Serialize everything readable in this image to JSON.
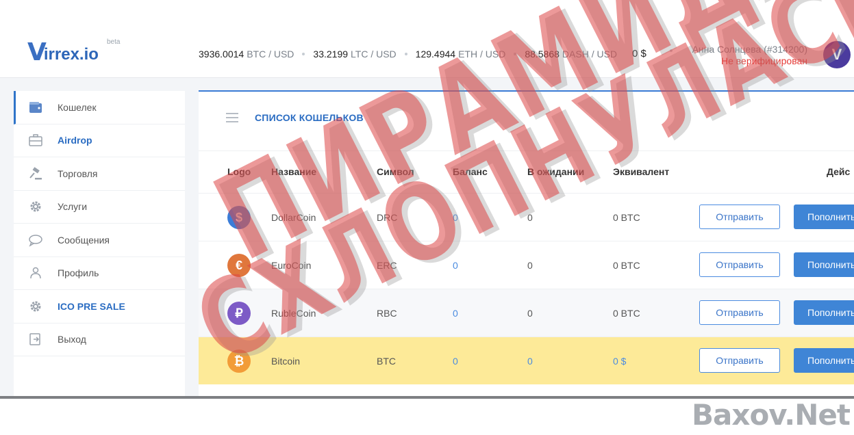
{
  "header": {
    "logo_mark": "V",
    "logo_text": "irrex.io",
    "logo_badge": "beta",
    "rates": [
      {
        "value": "3936.0014",
        "pair": "BTC / USD"
      },
      {
        "value": "33.2199",
        "pair": "LTC / USD"
      },
      {
        "value": "129.4944",
        "pair": "ETH / USD"
      },
      {
        "value": "88.5868",
        "pair": "DASH / USD"
      }
    ],
    "balance": "0 $",
    "user_name": "Анна Солнцева (#314200)",
    "user_status": "Не верифицирован",
    "avatar_letter": "V"
  },
  "sidebar": {
    "items": [
      {
        "label": "Кошелек",
        "icon": "wallet-icon"
      },
      {
        "label": "Airdrop",
        "icon": "briefcase-icon"
      },
      {
        "label": "Торговля",
        "icon": "gavel-icon"
      },
      {
        "label": "Услуги",
        "icon": "gear-icon"
      },
      {
        "label": "Сообщения",
        "icon": "chat-icon"
      },
      {
        "label": "Профиль",
        "icon": "user-icon"
      },
      {
        "label": "ICO PRE SALE",
        "icon": "gear-icon"
      },
      {
        "label": "Выход",
        "icon": "logout-icon"
      }
    ]
  },
  "main": {
    "title": "СПИСОК КОШЕЛЬКОВ",
    "columns": [
      "Logo",
      "Название",
      "Символ",
      "Баланс",
      "В ожидании",
      "Эквивалент",
      "Дейс"
    ],
    "rows": [
      {
        "icon": "dollar-coin-icon",
        "glyph": "$",
        "color": "#3b7dd8",
        "name": "DollarCoin",
        "symbol": "DRC",
        "balance": "0",
        "pending": "0",
        "equivalent": "0 BTC",
        "send": "Отправить",
        "topup": "Пополнить"
      },
      {
        "icon": "euro-coin-icon",
        "glyph": "€",
        "color": "#e0773c",
        "name": "EuroCoin",
        "symbol": "ERC",
        "balance": "0",
        "pending": "0",
        "equivalent": "0 BTC",
        "send": "Отправить",
        "topup": "Пополнить"
      },
      {
        "icon": "ruble-coin-icon",
        "glyph": "₽",
        "color": "#7d5bc6",
        "name": "RubleCoin",
        "symbol": "RBC",
        "balance": "0",
        "pending": "0",
        "equivalent": "0 BTC",
        "send": "Отправить",
        "topup": "Пополнить"
      },
      {
        "icon": "bitcoin-icon",
        "glyph": "₿",
        "color": "#f29c38",
        "name": "Bitcoin",
        "symbol": "BTC",
        "balance": "0",
        "pending": "0",
        "equivalent": "0 $",
        "send": "Отправить",
        "topup": "Пополнить"
      }
    ]
  },
  "stamp": {
    "line1": "ПИРАМИДА",
    "line2": "СХЛОПНУЛАСЬ"
  },
  "watermark": "Baxov.Net",
  "colors": {
    "accent": "#2f74c9",
    "button_primary": "#3f85d6",
    "status_error": "#e53935",
    "row_highlight": "#fdea98"
  }
}
